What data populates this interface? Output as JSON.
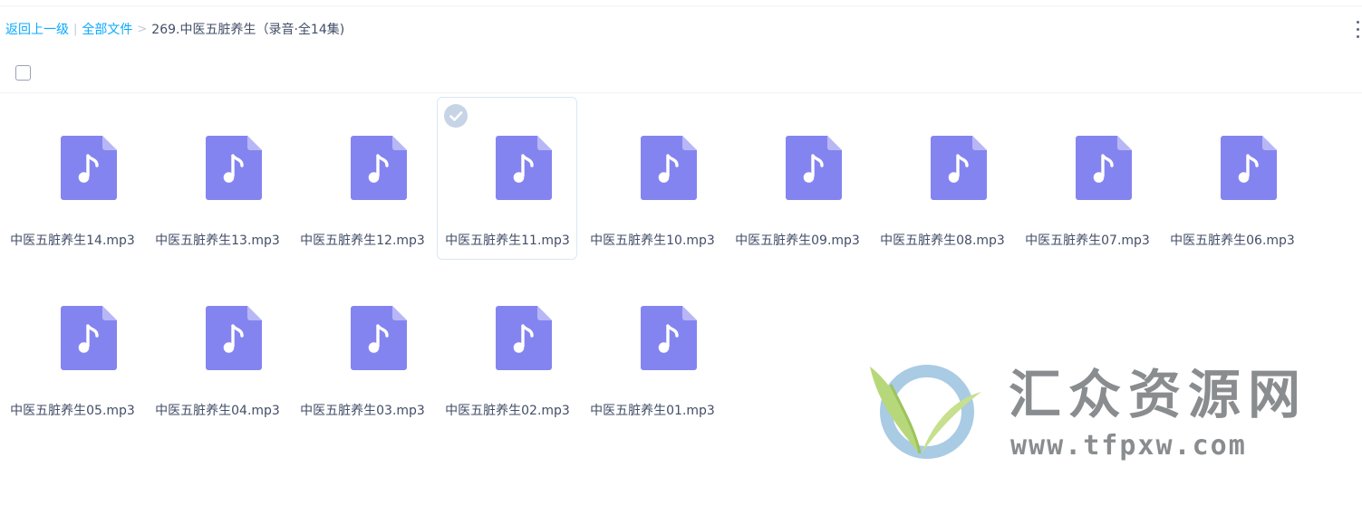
{
  "breadcrumb": {
    "back_label": "返回上一级",
    "separator_bar": "|",
    "all_files_label": "全部文件",
    "chevron": ">",
    "current_folder": "269.中医五脏养生（录音·全14集)"
  },
  "files": [
    {
      "name": "中医五脏养生14.mp3",
      "selected": false
    },
    {
      "name": "中医五脏养生13.mp3",
      "selected": false
    },
    {
      "name": "中医五脏养生12.mp3",
      "selected": false
    },
    {
      "name": "中医五脏养生11.mp3",
      "selected": true
    },
    {
      "name": "中医五脏养生10.mp3",
      "selected": false
    },
    {
      "name": "中医五脏养生09.mp3",
      "selected": false
    },
    {
      "name": "中医五脏养生08.mp3",
      "selected": false
    },
    {
      "name": "中医五脏养生07.mp3",
      "selected": false
    },
    {
      "name": "中医五脏养生06.mp3",
      "selected": false
    },
    {
      "name": "中医五脏养生05.mp3",
      "selected": false
    },
    {
      "name": "中医五脏养生04.mp3",
      "selected": false
    },
    {
      "name": "中医五脏养生03.mp3",
      "selected": false
    },
    {
      "name": "中医五脏养生02.mp3",
      "selected": false
    },
    {
      "name": "中医五脏养生01.mp3",
      "selected": false
    }
  ],
  "icons": {
    "file": "audio-file-icon",
    "check": "check-circle-icon",
    "more": "more-vertical-icon"
  },
  "colors": {
    "link": "#09aaff",
    "audio_icon": "#8484f0",
    "audio_icon_fold": "#b7b7f7",
    "selected_border": "#dce7f3",
    "check": "#c6d4e6"
  },
  "watermark": {
    "title": "汇众资源网",
    "url": "www.tfpxw.com"
  }
}
